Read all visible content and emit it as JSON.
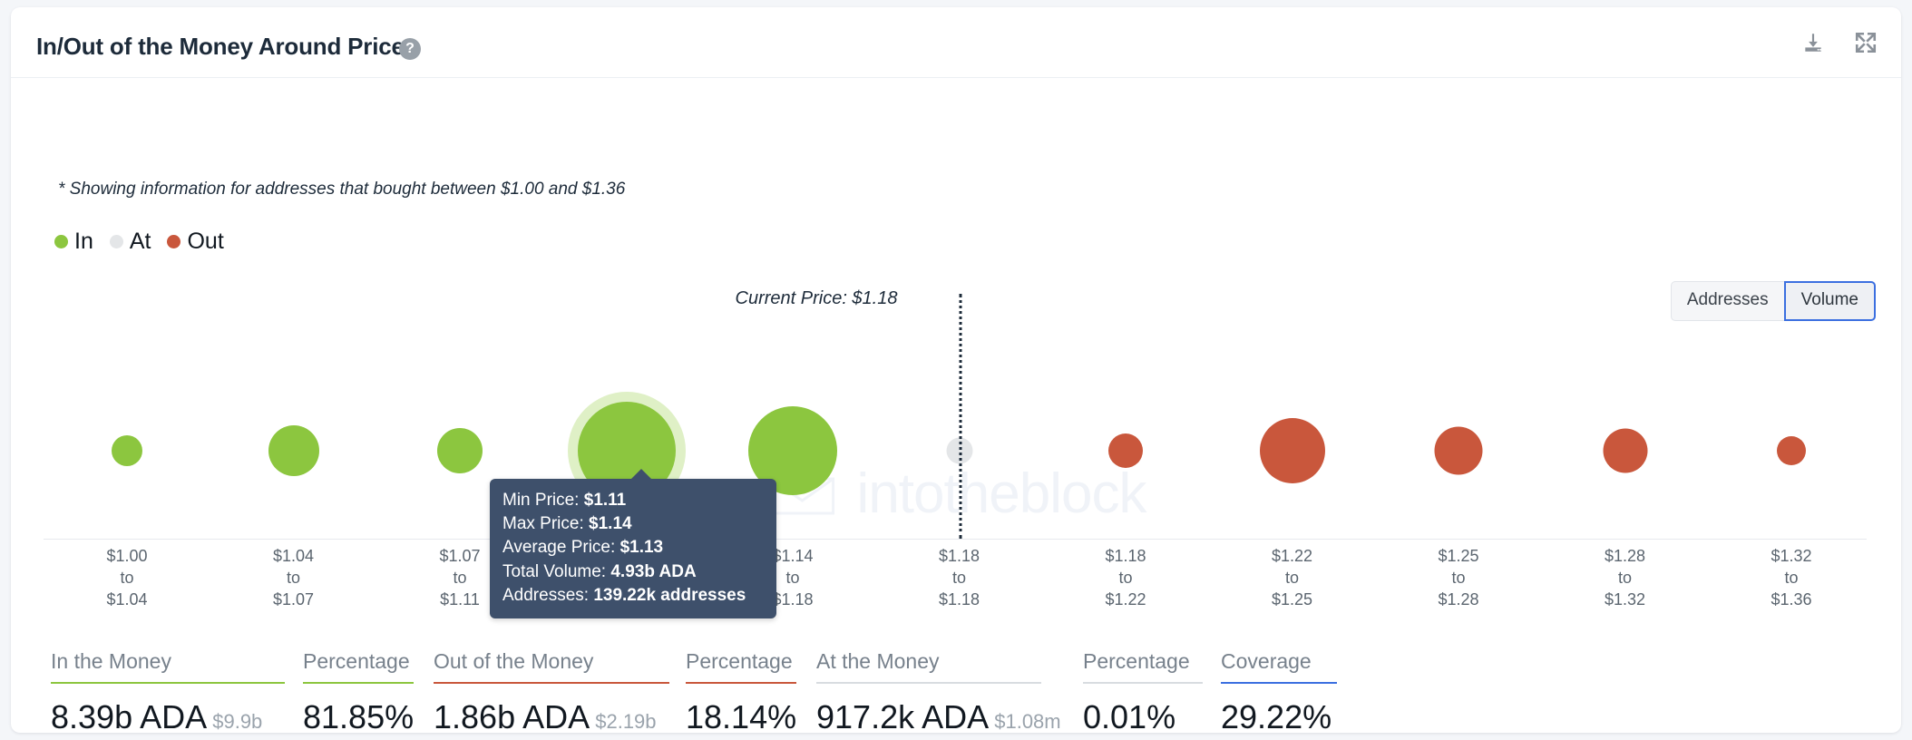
{
  "header": {
    "title": "In/Out of the Money Around Price",
    "help_icon": "help-circle-icon",
    "download_icon": "download-icon",
    "expand_icon": "expand-icon"
  },
  "note": "* Showing information for addresses that bought between $1.00 and $1.36",
  "legend": [
    {
      "label": "In",
      "color": "#8CC63F"
    },
    {
      "label": "At",
      "color": "#E4E6E8"
    },
    {
      "label": "Out",
      "color": "#C9573C"
    }
  ],
  "toggle": {
    "options": [
      "Addresses",
      "Volume"
    ],
    "selected": "Volume",
    "accent": "#3b6fe0"
  },
  "watermark": "intotheblock",
  "current_price": {
    "label": "Current Price: $1.18",
    "value": 1.18
  },
  "tooltip": {
    "rows": [
      {
        "label": "Min Price:",
        "value": "$1.11"
      },
      {
        "label": "Max Price:",
        "value": "$1.14"
      },
      {
        "label": "Average Price:",
        "value": "$1.13"
      },
      {
        "label": "Total Volume:",
        "value": "4.93b ADA"
      },
      {
        "label": "Addresses:",
        "value": "139.22k addresses"
      }
    ]
  },
  "chart_data": {
    "type": "scatter",
    "title": "In/Out of the Money Around Price",
    "xlabel": "",
    "ylabel": "",
    "grid": false,
    "legend_position": "top-left",
    "metric": "Volume",
    "categories": [
      "$1.00\nto\n$1.04",
      "$1.04\nto\n$1.07",
      "$1.07\nto\n$1.11",
      "$1.11\nto\n$1.14",
      "$1.14\nto\n$1.18",
      "$1.18\nto\n$1.18",
      "$1.18\nto\n$1.22",
      "$1.22\nto\n$1.25",
      "$1.25\nto\n$1.28",
      "$1.28\nto\n$1.32",
      "$1.32\nto\n$1.36"
    ],
    "points": [
      {
        "min": "$1.00",
        "max": "$1.04",
        "status": "In",
        "color": "#8CC63F",
        "size": 34,
        "highlight": false
      },
      {
        "min": "$1.04",
        "max": "$1.07",
        "status": "In",
        "color": "#8CC63F",
        "size": 56,
        "highlight": false
      },
      {
        "min": "$1.07",
        "max": "$1.11",
        "status": "In",
        "color": "#8CC63F",
        "size": 50,
        "highlight": false
      },
      {
        "min": "$1.11",
        "max": "$1.14",
        "status": "In",
        "color": "#8CC63F",
        "size": 108,
        "highlight": true
      },
      {
        "min": "$1.14",
        "max": "$1.18",
        "status": "In",
        "color": "#8CC63F",
        "size": 98,
        "highlight": false
      },
      {
        "min": "$1.18",
        "max": "$1.18",
        "status": "At",
        "color": "#E4E6E8",
        "size": 29,
        "highlight": false
      },
      {
        "min": "$1.18",
        "max": "$1.22",
        "status": "Out",
        "color": "#C9573C",
        "size": 38,
        "highlight": false
      },
      {
        "min": "$1.22",
        "max": "$1.25",
        "status": "Out",
        "color": "#C9573C",
        "size": 72,
        "highlight": false
      },
      {
        "min": "$1.25",
        "max": "$1.28",
        "status": "Out",
        "color": "#C9573C",
        "size": 53,
        "highlight": false
      },
      {
        "min": "$1.28",
        "max": "$1.32",
        "status": "Out",
        "color": "#C9573C",
        "size": 49,
        "highlight": false
      },
      {
        "min": "$1.32",
        "max": "$1.36",
        "status": "Out",
        "color": "#C9573C",
        "size": 32,
        "highlight": false
      }
    ]
  },
  "stats": [
    {
      "label": "In the Money",
      "rule_color": "#8CC63F",
      "value": "8.39b ADA",
      "sub": "$9.9b"
    },
    {
      "label": "Percentage",
      "rule_color": "#8CC63F",
      "value": "81.85%",
      "sub": ""
    },
    {
      "label": "Out of the Money",
      "rule_color": "#C9573C",
      "value": "1.86b ADA",
      "sub": "$2.19b"
    },
    {
      "label": "Percentage",
      "rule_color": "#C9573C",
      "value": "18.14%",
      "sub": ""
    },
    {
      "label": "At the Money",
      "rule_color": "#D8DCE0",
      "value": "917.2k ADA",
      "sub": "$1.08m"
    },
    {
      "label": "Percentage",
      "rule_color": "#D8DCE0",
      "value": "0.01%",
      "sub": ""
    },
    {
      "label": "Coverage",
      "rule_color": "#3b6fe0",
      "value": "29.22%",
      "sub": ""
    }
  ]
}
